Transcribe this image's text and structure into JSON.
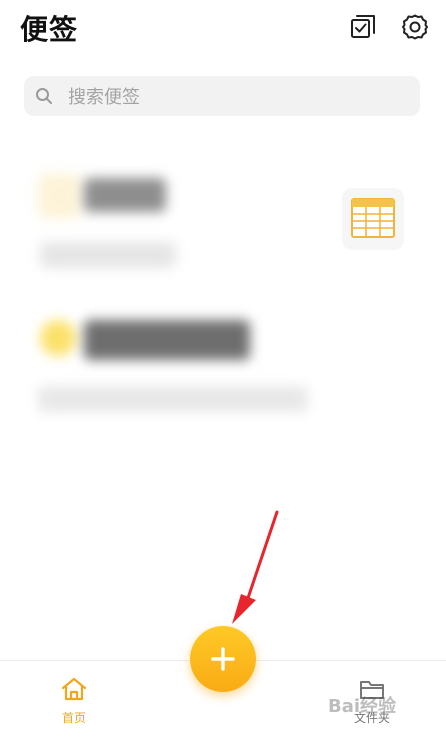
{
  "header": {
    "title": "便签",
    "multiselect_icon": "checkbox-multi-icon",
    "settings_icon": "gear-icon"
  },
  "search": {
    "placeholder": "搜索便签",
    "icon": "search-icon"
  },
  "notes": [
    {
      "blurred": true,
      "accent_color": "#fdf3d8",
      "has_thumbnail": true,
      "thumbnail_icon": "table-icon"
    },
    {
      "blurred": true,
      "accent_color": "#fbe16a",
      "has_thumbnail": false
    }
  ],
  "fab": {
    "icon": "plus-icon",
    "color": "#ffbf20"
  },
  "tabbar": {
    "home_label": "首页",
    "folder_label": "文件夹",
    "home_icon": "home-icon",
    "folder_icon": "folder-icon",
    "active_color": "#f2a71b"
  },
  "annotation": {
    "arrow_color": "#e8252c"
  },
  "watermark": {
    "text": "Bai经验"
  }
}
